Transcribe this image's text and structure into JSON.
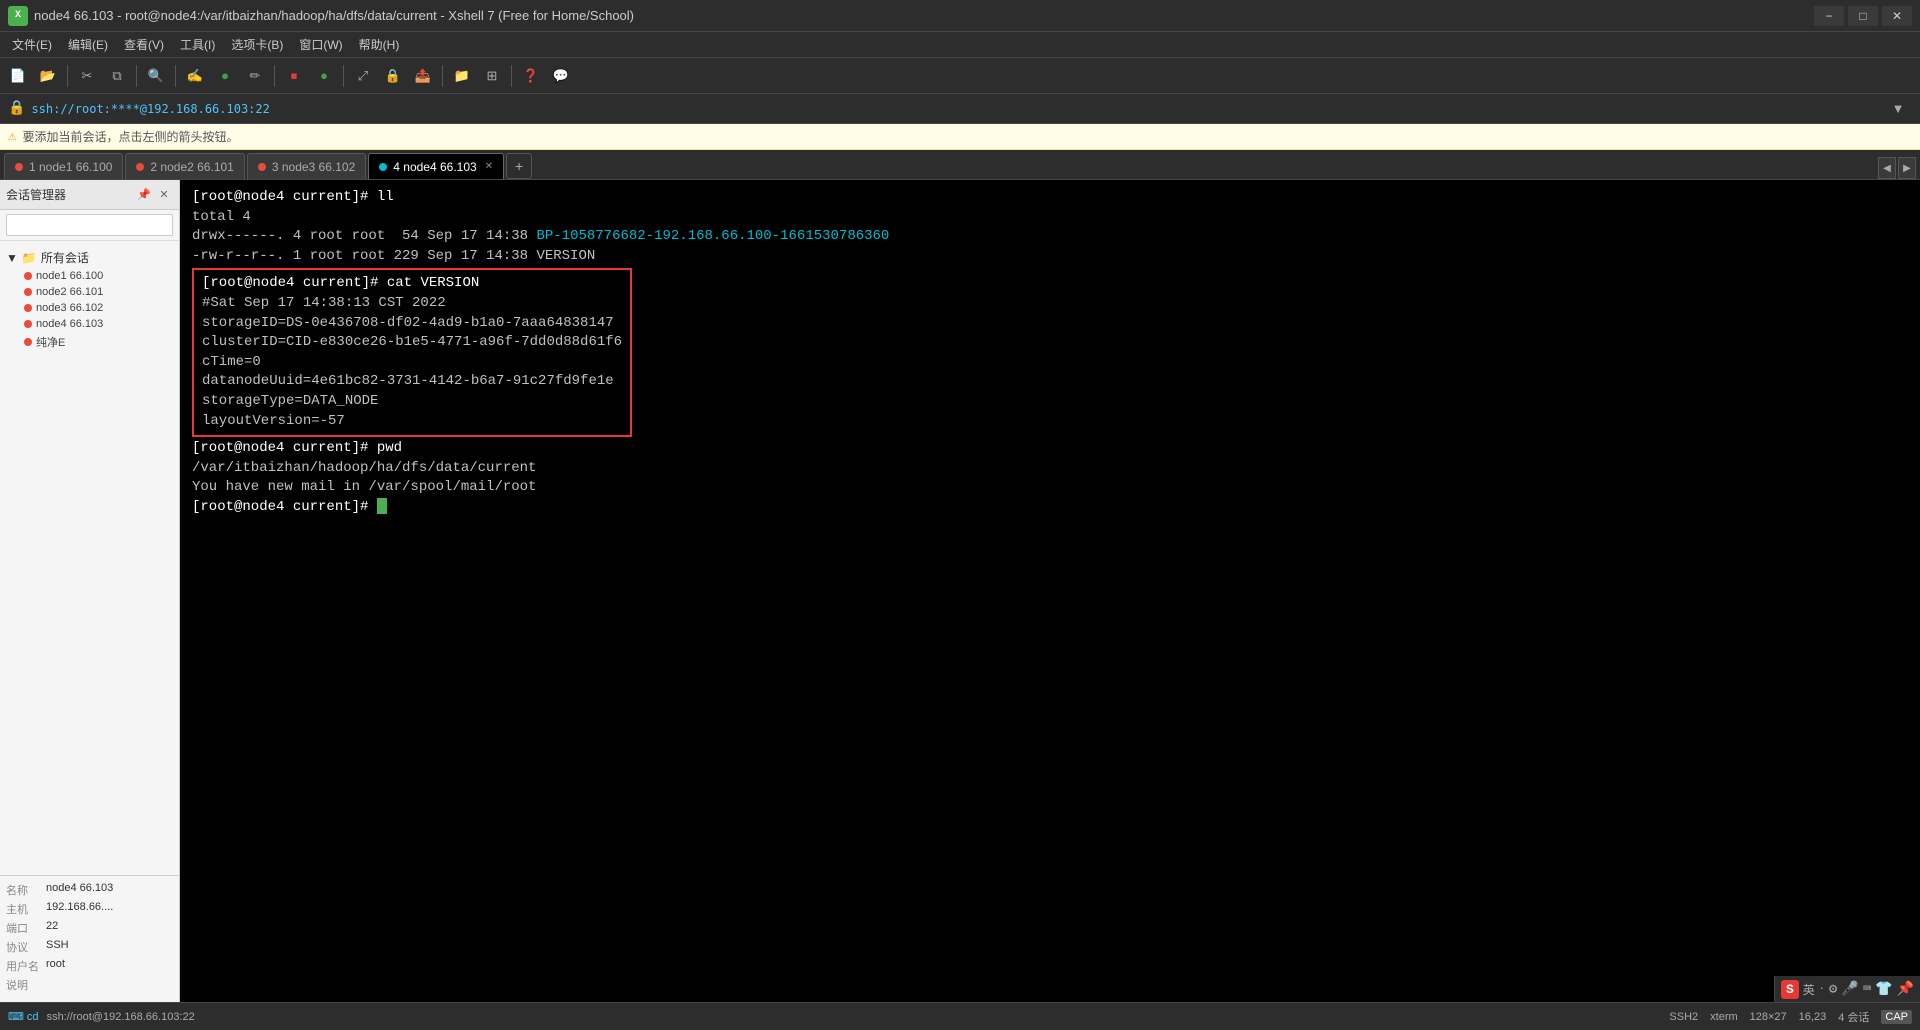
{
  "titlebar": {
    "title": "node4 66.103 - root@node4:/var/itbaizhan/hadoop/ha/dfs/data/current - Xshell 7 (Free for Home/School)",
    "min_label": "−",
    "max_label": "□",
    "close_label": "✕"
  },
  "menubar": {
    "items": [
      "文件(E)",
      "编辑(E)",
      "查看(V)",
      "工具(I)",
      "选项卡(B)",
      "窗口(W)",
      "帮助(H)"
    ]
  },
  "addressbar": {
    "text": "ssh://root:****@192.168.66.103:22"
  },
  "session_warning": {
    "text": "要添加当前会话，点击左侧的箭头按钮。"
  },
  "sidebar": {
    "title": "会话管理器",
    "search_placeholder": "",
    "tree": {
      "root_label": "所有会话",
      "nodes": [
        {
          "label": "node1 66.100"
        },
        {
          "label": "node2 66.101"
        },
        {
          "label": "node3 66.102"
        },
        {
          "label": "node4 66.103"
        },
        {
          "label": "纯净E"
        }
      ]
    },
    "info": {
      "name_label": "名称",
      "name_value": "node4 66.103",
      "host_label": "主机",
      "host_value": "192.168.66....",
      "port_label": "端口",
      "port_value": "22",
      "protocol_label": "协议",
      "protocol_value": "SSH",
      "user_label": "用户名",
      "user_value": "root",
      "desc_label": "说明",
      "desc_value": ""
    }
  },
  "tabs": [
    {
      "id": "tab1",
      "label": "1 node1 66.100",
      "active": false,
      "color": "#e74c3c"
    },
    {
      "id": "tab2",
      "label": "2 node2 66.101",
      "active": false,
      "color": "#e74c3c"
    },
    {
      "id": "tab3",
      "label": "3 node3 66.102",
      "active": false,
      "color": "#e74c3c"
    },
    {
      "id": "tab4",
      "label": "4 node4 66.103",
      "active": true,
      "color": "#00bcd4"
    }
  ],
  "terminal": {
    "lines": [
      {
        "type": "prompt",
        "text": "[root@node4 current]# ll"
      },
      {
        "type": "normal",
        "text": "total 4"
      },
      {
        "type": "mixed",
        "parts": [
          {
            "text": "drwx------. 4 root root  54 Sep 17 14:38 ",
            "color": "#c0c0c0"
          },
          {
            "text": "BP-1058776682-192.168.66.100-1661530786360",
            "color": "#00bcd4"
          }
        ]
      },
      {
        "type": "normal",
        "text": "-rw-r--r--. 1 root root 229 Sep 17 14:38 VERSION"
      },
      {
        "type": "boxed",
        "lines": [
          {
            "type": "prompt",
            "text": "[root@node4 current]# cat VERSION"
          },
          {
            "type": "normal",
            "text": "#Sat Sep 17 14:38:13 CST 2022"
          },
          {
            "type": "normal",
            "text": "storageID=DS-0e436708-df02-4ad9-b1a0-7aaa64838147"
          },
          {
            "type": "normal",
            "text": "clusterID=CID-e830ce26-b1e5-4771-a96f-7dd0d88d61f6"
          },
          {
            "type": "normal",
            "text": "cTime=0"
          },
          {
            "type": "normal",
            "text": "datanodeUuid=4e61bc82-3731-4142-b6a7-91c27fd9fe1e"
          },
          {
            "type": "normal",
            "text": "storageType=DATA_NODE"
          },
          {
            "type": "normal",
            "text": "layoutVersion=-57"
          }
        ]
      },
      {
        "type": "prompt",
        "text": "[root@node4 current]# pwd"
      },
      {
        "type": "normal",
        "text": "/var/itbaizhan/hadoop/ha/dfs/data/current"
      },
      {
        "type": "normal",
        "text": "You have new mail in /var/spool/mail/root"
      },
      {
        "type": "prompt_cursor",
        "text": "[root@node4 current]# "
      }
    ]
  },
  "statusbar": {
    "cd_label": "cd",
    "ssh_label": "SSH2",
    "xterm_label": "xterm",
    "size_label": "128×27",
    "position_label": "16,23",
    "sessions_label": "4 会话",
    "cap_label": "CAP",
    "bottom_path": "ssh://root@192.168.66.103:22"
  }
}
